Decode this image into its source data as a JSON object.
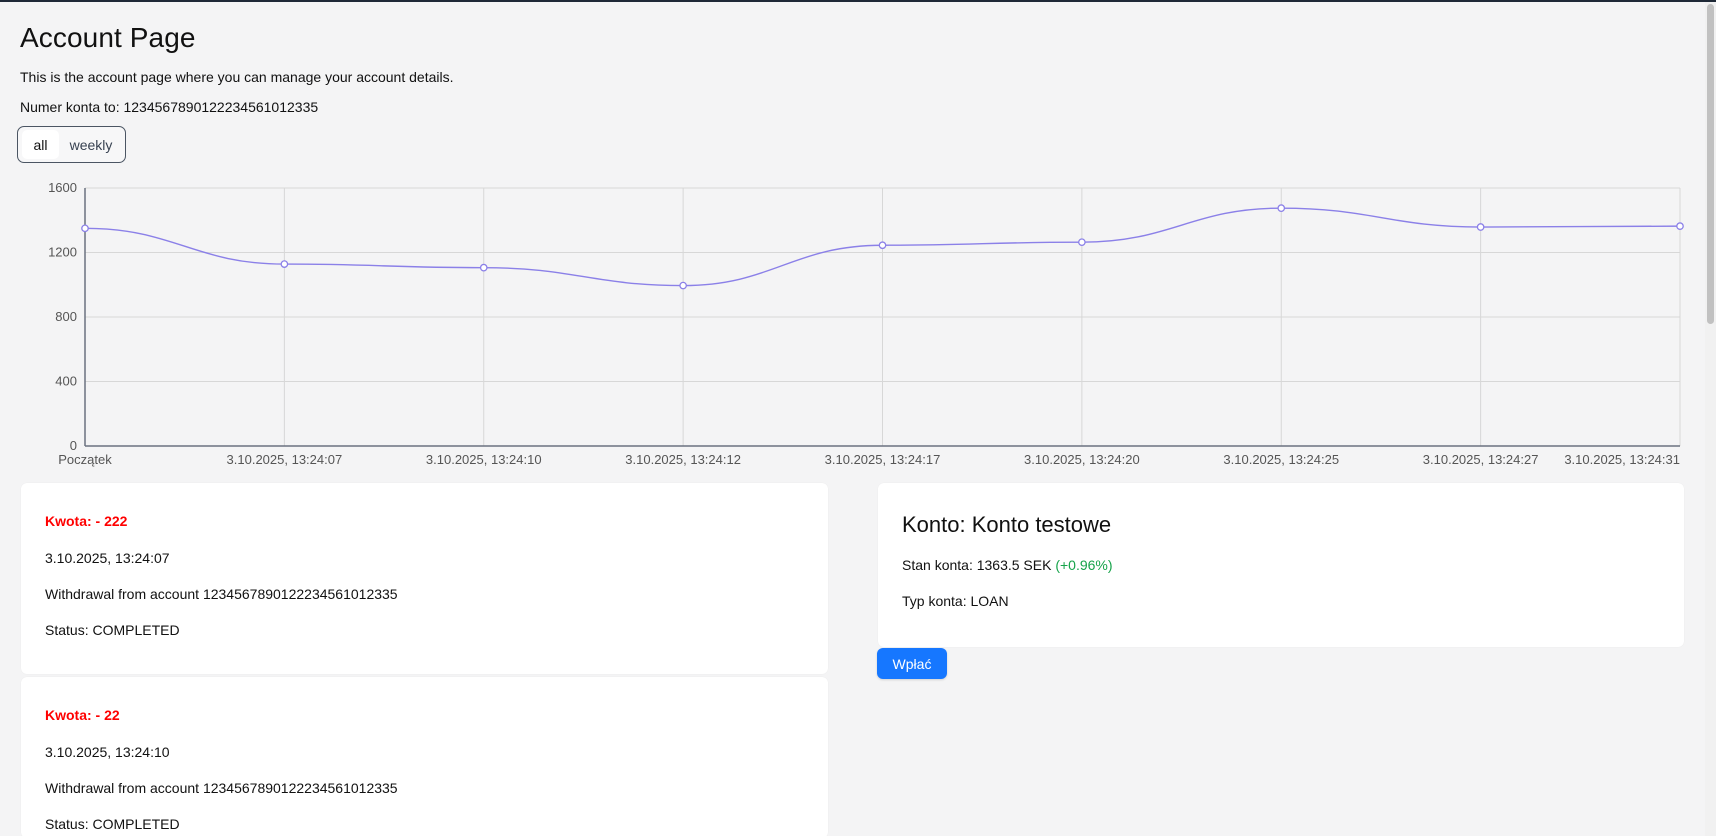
{
  "page": {
    "title": "Account Page",
    "subtitle": "This is the account page where you can manage your account details.",
    "account_number_text": "Numer konta to: 1234567890122234561012335"
  },
  "toggle": {
    "all": "all",
    "weekly": "weekly",
    "selected": "all"
  },
  "chart_data": {
    "type": "line",
    "categories": [
      "Początek",
      "3.10.2025, 13:24:07",
      "3.10.2025, 13:24:10",
      "3.10.2025, 13:24:12",
      "3.10.2025, 13:24:17",
      "3.10.2025, 13:24:20",
      "3.10.2025, 13:24:25",
      "3.10.2025, 13:24:27",
      "3.10.2025, 13:24:31"
    ],
    "series": [
      {
        "values": [
          1350,
          1128,
          1106,
          995,
          1245,
          1264,
          1475,
          1358,
          1363.5
        ],
        "color": "#8b80e8"
      }
    ],
    "yticks": [
      "0",
      "400",
      "800",
      "1200",
      "1600"
    ],
    "ylim": [
      0,
      1600
    ],
    "grid": true,
    "xlabel": "",
    "ylabel": ""
  },
  "transactions": [
    {
      "amount": "Kwota: - 222",
      "date": "3.10.2025, 13:24:07",
      "description": "Withdrawal from account 1234567890122234561012335",
      "status": "Status: COMPLETED"
    },
    {
      "amount": "Kwota: - 22",
      "date": "3.10.2025, 13:24:10",
      "description": "Withdrawal from account 1234567890122234561012335",
      "status": "Status: COMPLETED"
    }
  ],
  "account": {
    "title": "Konto: Konto testowe",
    "balance_label": "Stan konta: 1363.5 SEK ",
    "change": "(+0.96%)",
    "type": "Typ konta: LOAN"
  },
  "actions": {
    "deposit": "Wpłać"
  },
  "colors": {
    "accent": "#1677ff",
    "negative_amount": "#ff0000",
    "positive_change": "#16a34a"
  }
}
